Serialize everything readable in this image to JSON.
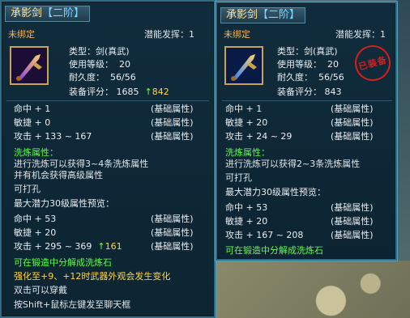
{
  "left": {
    "title": "承影剑",
    "grade": "【二阶】",
    "binding": "未绑定",
    "potential": "潜能发挥：1",
    "type": "类型：剑(真武)",
    "level_label": "使用等级：",
    "level": "20",
    "durability_label": "耐久度：",
    "durability": "56/56",
    "rating_label": "装备评分：",
    "rating": "1685",
    "rating_up": "842",
    "attrs": [
      {
        "name": "命中 + 1",
        "tag": "(基础属性)"
      },
      {
        "name": "敏捷 + 0",
        "tag": "(基础属性)"
      },
      {
        "name": "攻击 + 133 ~ 167",
        "tag": "(基础属性)"
      }
    ],
    "refine_title": "洗炼属性：",
    "refine_line1": "进行洗炼可以获得3~4条洗炼属性",
    "refine_line2": "并有机会获得高级属性",
    "perforate": "可打孔",
    "max_potential_title": "最大潜力30级属性预览：",
    "max_attrs": [
      {
        "name": "命中 + 53",
        "tag": "(基础属性)"
      },
      {
        "name": "敏捷 + 20",
        "tag": "(基础属性)"
      },
      {
        "name": "攻击 + 295 ~ 369",
        "tag": "(基础属性)",
        "up": "161"
      }
    ],
    "decompose": "可在锻造中分解成洗炼石",
    "enhance_tip": "强化至+9、+12时武器外观会发生变化",
    "double_click": "双击可以穿戴",
    "shift_tip": "按Shift+鼠标左键发至聊天框"
  },
  "right": {
    "title": "承影剑",
    "grade": "【二阶】",
    "binding": "未绑定",
    "potential": "潜能发挥：1",
    "type": "类型：剑(真武)",
    "level_label": "使用等级：",
    "level": "20",
    "durability_label": "耐久度：",
    "durability": "56/56",
    "rating_label": "装备评分：",
    "rating": "843",
    "seal_text": "已装备",
    "attrs": [
      {
        "name": "命中 + 1",
        "tag": "(基础属性)"
      },
      {
        "name": "敏捷 + 20",
        "tag": "(基础属性)"
      },
      {
        "name": "攻击 + 24 ~ 29",
        "tag": "(基础属性)"
      }
    ],
    "refine_title": "洗炼属性：",
    "refine_line1": "进行洗炼可以获得2~3条洗炼属性",
    "perforate": "可打孔",
    "max_potential_title": "最大潜力30级属性预览：",
    "max_attrs": [
      {
        "name": "命中 + 53",
        "tag": "(基础属性)"
      },
      {
        "name": "敏捷 + 20",
        "tag": "(基础属性)"
      },
      {
        "name": "攻击 + 167 ~ 208",
        "tag": "(基础属性)"
      }
    ],
    "decompose": "可在锻造中分解成洗炼石"
  },
  "icons": {
    "up_arrow": "up-arrow-icon",
    "sword": "sword-icon"
  }
}
